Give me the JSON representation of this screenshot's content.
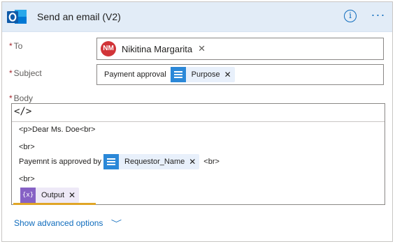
{
  "header": {
    "title": "Send an email (V2)",
    "info_icon": "i",
    "more_icon": "···",
    "app_icon": "outlook-icon",
    "colors": {
      "header_bg": "#e2ecf7",
      "accent": "#0f6cbd"
    }
  },
  "fields": {
    "to": {
      "required_mark": "*",
      "label": "To",
      "person": {
        "initials": "NM",
        "name": "Nikitina Margarita",
        "remove": "✕"
      }
    },
    "subject": {
      "required_mark": "*",
      "label": "Subject",
      "prefix_text": "Payment approval",
      "token": {
        "label": "Purpose",
        "remove": "✕"
      }
    },
    "body": {
      "required_mark": "*",
      "label": "Body",
      "code_view_label": "</>",
      "lines": [
        "<p>Dear Ms. Doe<br>",
        "<br>",
        "Payemnt is approved by",
        "<br>"
      ],
      "requestor_token": {
        "label": "Requestor_Name",
        "remove": "✕",
        "suffix": "<br>"
      },
      "output_token": {
        "icon": "{x}",
        "label": "Output",
        "remove": "✕"
      }
    }
  },
  "advanced": {
    "label": "Show advanced options",
    "chevron": "﹀"
  }
}
